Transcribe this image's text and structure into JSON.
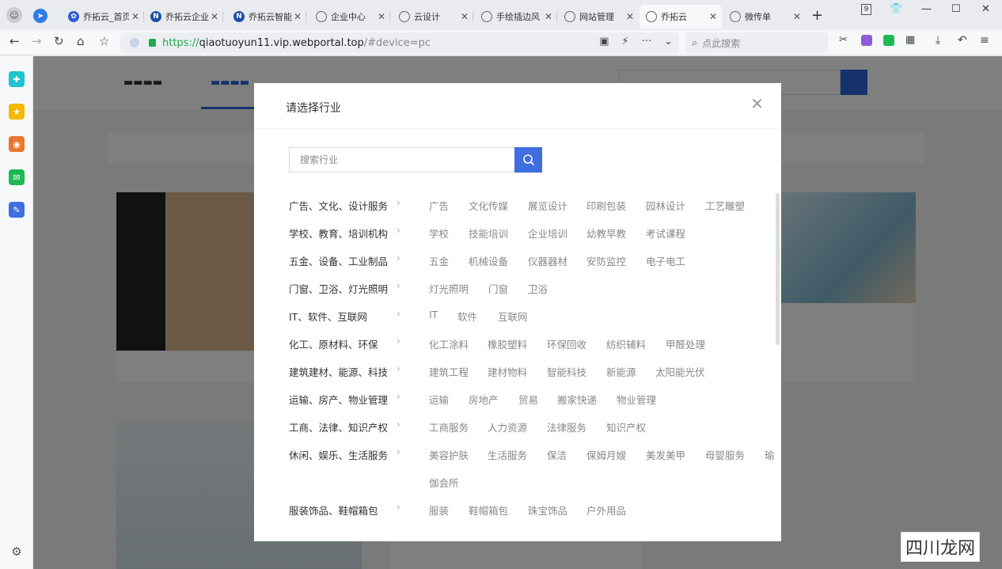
{
  "browser": {
    "tabs": [
      {
        "title": "乔拓云_首页",
        "icon": "paw-icon"
      },
      {
        "title": "乔拓云企业",
        "icon": "n-logo-icon"
      },
      {
        "title": "乔拓云智能",
        "icon": "n-logo-icon"
      },
      {
        "title": "企业中心",
        "icon": "globe-icon"
      },
      {
        "title": "云设计",
        "icon": "globe-icon"
      },
      {
        "title": "手绘插边风",
        "icon": "globe-icon"
      },
      {
        "title": "网站管理",
        "icon": "globe-icon"
      },
      {
        "title": "乔拓云",
        "icon": "globe-icon"
      },
      {
        "title": "微传单",
        "icon": "globe-icon"
      }
    ],
    "active_tab": 7,
    "url_scheme": "https://",
    "url_host": "qiaotuoyun11.vip.webportal.top",
    "url_path": "/#device=pc",
    "search_placeholder": "点此搜索",
    "tab_badge": "9"
  },
  "modal": {
    "title": "请选择行业",
    "search_placeholder": "搜索行业",
    "rows": [
      {
        "category": "广告、文化、设计服务",
        "items": [
          "广告",
          "文化传媒",
          "展览设计",
          "印刷包装",
          "园林设计",
          "工艺雕塑"
        ]
      },
      {
        "category": "学校、教育、培训机构",
        "items": [
          "学校",
          "技能培训",
          "企业培训",
          "幼教早教",
          "考试课程"
        ]
      },
      {
        "category": "五金、设备、工业制品",
        "items": [
          "五金",
          "机械设备",
          "仪器器材",
          "安防监控",
          "电子电工"
        ]
      },
      {
        "category": "门窗、卫浴、灯光照明",
        "items": [
          "灯光照明",
          "门窗",
          "卫浴"
        ]
      },
      {
        "category": "IT、软件、互联网",
        "items": [
          "IT",
          "软件",
          "互联网"
        ]
      },
      {
        "category": "化工、原材料、环保",
        "items": [
          "化工涂料",
          "橡胶塑料",
          "环保回收",
          "纺织辅料",
          "甲醛处理"
        ]
      },
      {
        "category": "建筑建材、能源、科技",
        "items": [
          "建筑工程",
          "建材物料",
          "智能科技",
          "新能源",
          "太阳能光伏"
        ]
      },
      {
        "category": "运输、房产、物业管理",
        "items": [
          "运输",
          "房地产",
          "贸易",
          "搬家快递",
          "物业管理"
        ]
      },
      {
        "category": "工商、法律、知识产权",
        "items": [
          "工商服务",
          "人力资源",
          "法律服务",
          "知识产权"
        ]
      },
      {
        "category": "休闲、娱乐、生活服务",
        "items": [
          "美容护肤",
          "生活服务",
          "保洁",
          "保姆月嫂",
          "美发美甲",
          "母婴服务",
          "瑜",
          "伽会所"
        ]
      },
      {
        "category": "服装饰品、鞋帽箱包",
        "items": [
          "服装",
          "鞋帽箱包",
          "珠宝饰品",
          "户外用品"
        ]
      }
    ]
  },
  "watermark": "四川龙网",
  "colors": {
    "accent": "#3f6ee0",
    "overlay": "rgba(0,0,0,0.5)",
    "secure": "#1da851"
  }
}
